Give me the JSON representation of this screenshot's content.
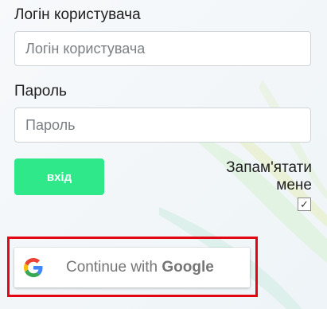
{
  "form": {
    "username_label": "Логін користувача",
    "username_placeholder": "Логін користувача",
    "password_label": "Пароль",
    "password_placeholder": "Пароль",
    "login_button": "вхід",
    "remember_me_label": "Запам'ятати мене",
    "remember_me_checked": true,
    "checkbox_mark": "✓"
  },
  "google": {
    "prefix": "Continue with ",
    "brand": "Google",
    "icon": "google-g-icon"
  },
  "colors": {
    "login_button": "#2ee88a",
    "highlight_border": "#e30613",
    "google_text": "#757575"
  }
}
